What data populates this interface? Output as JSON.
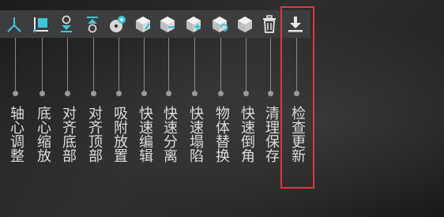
{
  "toolbar": {
    "tools": [
      {
        "icon": "axis-pivot-icon",
        "label": "轴心调整"
      },
      {
        "icon": "bottom-pivot-scale-icon",
        "label": "底心缩放"
      },
      {
        "icon": "align-bottom-icon",
        "label": "对齐底部"
      },
      {
        "icon": "align-top-icon",
        "label": "对齐顶部"
      },
      {
        "icon": "snap-place-icon",
        "label": "吸附放置"
      },
      {
        "icon": "quick-edit-icon",
        "label": "快速编辑"
      },
      {
        "icon": "quick-split-icon",
        "label": "快速分离"
      },
      {
        "icon": "quick-collapse-icon",
        "label": "快速塌陷"
      },
      {
        "icon": "object-replace-icon",
        "label": "物体替换"
      },
      {
        "icon": "quick-chamfer-icon",
        "label": "快速倒角"
      },
      {
        "icon": "clean-save-icon",
        "label": "清理保存"
      },
      {
        "icon": "check-update-icon",
        "label": "检查更新"
      }
    ]
  },
  "colors": {
    "accent": "#3ec6d8",
    "highlight_border": "#e2373a",
    "toolbar_bg": "#3c3d3f",
    "label_text": "#dcdcdc"
  }
}
